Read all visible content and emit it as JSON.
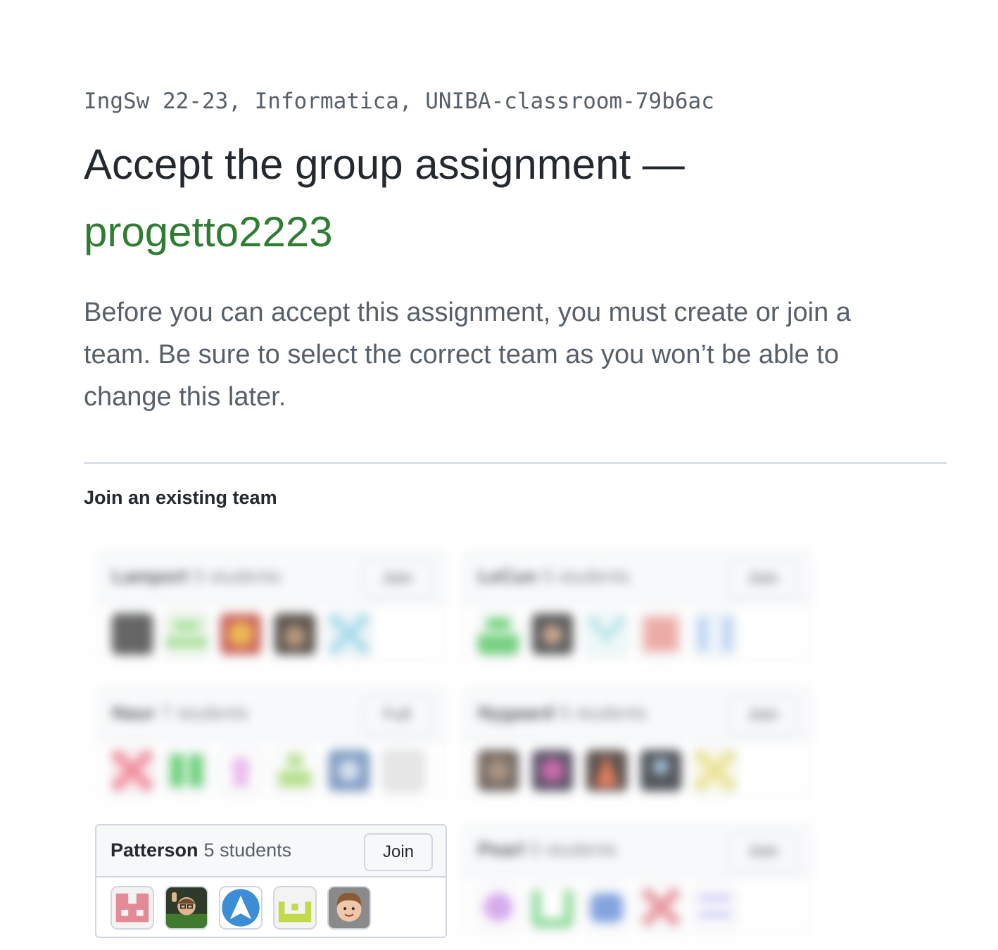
{
  "classroom_name": "IngSw 22-23, Informatica, UNIBA-classroom-79b6ac",
  "title_prefix": "Accept the group assignment —",
  "assignment_name": "progetto2223",
  "lead_text": "Before you can accept this assignment, you must create or join a team. Be sure to select the correct team as you won’t be able to change this later.",
  "section_heading": "Join an existing team",
  "teams": [
    {
      "name": "Lamport",
      "count": "5 students",
      "button": "Join",
      "blurred": true
    },
    {
      "name": "LeCun",
      "count": "5 students",
      "button": "Join",
      "blurred": true
    },
    {
      "name": "Naur",
      "count": "7 students",
      "button": "Full",
      "blurred": true
    },
    {
      "name": "Nygaard",
      "count": "5 students",
      "button": "Join",
      "blurred": true
    },
    {
      "name": "Patterson",
      "count": "5 students",
      "button": "Join",
      "blurred": false
    },
    {
      "name": "Pearl",
      "count": "5 students",
      "button": "Join",
      "blurred": true
    }
  ],
  "colors": {
    "accent_green": "#2f7d32",
    "muted_text": "#57606a",
    "border": "#d0d7de"
  },
  "patterson_avatars": [
    "identicon-pink-avatar",
    "memoji-waving-avatar",
    "arch-logo-avatar",
    "identicon-lime-avatar",
    "memoji-curly-avatar"
  ]
}
